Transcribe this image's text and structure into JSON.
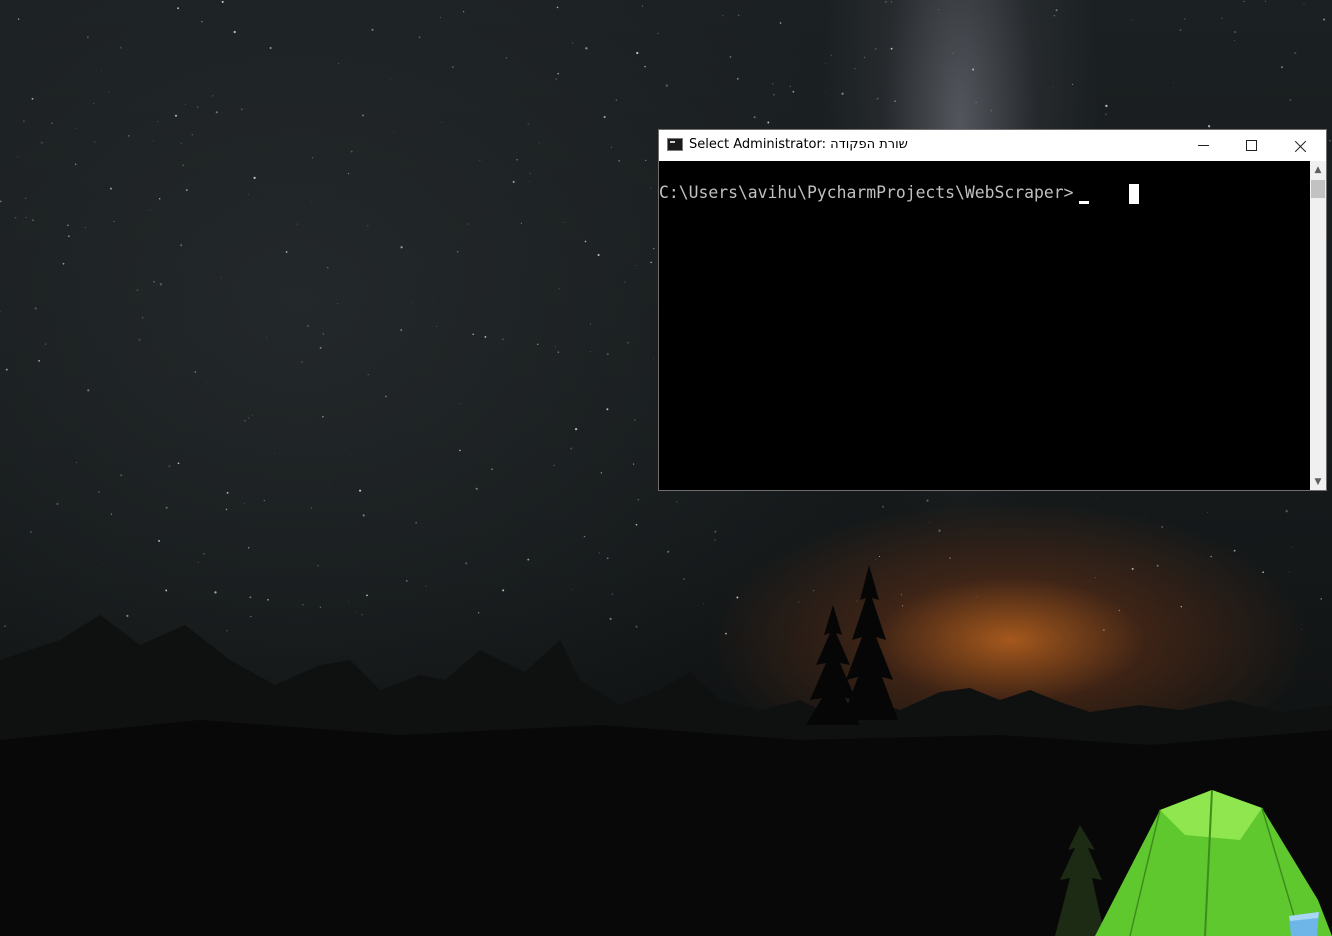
{
  "window": {
    "title": "Select Administrator: שורת הפקודה",
    "icon": "console-icon",
    "buttons": {
      "minimize": "minimize-icon",
      "maximize": "maximize-icon",
      "close": "close-icon"
    }
  },
  "console": {
    "prompt": "C:\\Users\\avihu\\PycharmProjects\\WebScraper>"
  },
  "scrollbar": {
    "up_arrow": "▲",
    "down_arrow": "▼"
  },
  "desktop": {
    "wallpaper": "night-sky-mountains-tent",
    "icons": [
      "recycle-bin-icon"
    ]
  },
  "colors": {
    "console_bg": "#000000",
    "console_text": "#c0c0c0",
    "titlebar_bg": "#ffffff",
    "tent_green": "#6fd23a",
    "horizon_glow": "#d66e1e"
  }
}
